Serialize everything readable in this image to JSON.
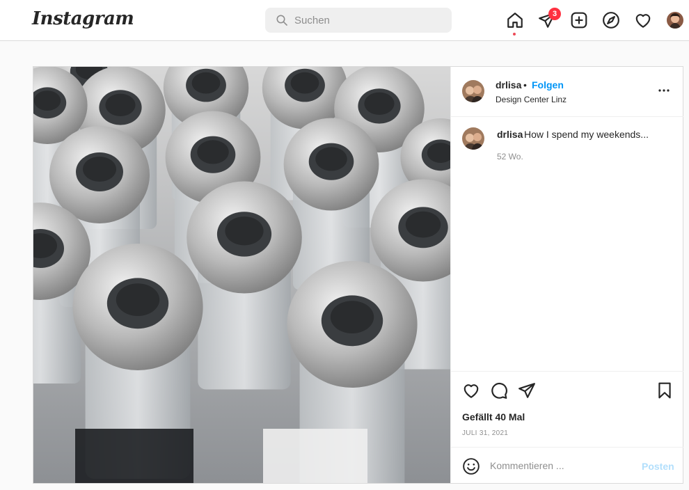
{
  "brand": {
    "logo_text": "Instagram"
  },
  "search": {
    "placeholder": "Suchen"
  },
  "nav": {
    "icons": [
      "home-icon",
      "direct-icon",
      "new-post-icon",
      "explore-icon",
      "activity-icon",
      "profile-avatar"
    ],
    "direct_badge": "3",
    "active": "home"
  },
  "post": {
    "header": {
      "username": "drlisa",
      "separator": "•",
      "follow_label": "Folgen",
      "location": "Design Center Linz"
    },
    "caption": {
      "username": "drlisa",
      "text": "How I spend my weekends...",
      "time": "52 Wo."
    },
    "likes": "Gefällt 40 Mal",
    "date": "JULI 31, 2021",
    "comment": {
      "placeholder": "Kommentieren ...",
      "post_label": "Posten"
    },
    "media_description_icon": "vaccine-vials-photo"
  },
  "colors": {
    "accent": "#0095f6",
    "badge": "#ff3040",
    "post_disabled": "#b2dffc",
    "border": "#dbdbdb"
  }
}
